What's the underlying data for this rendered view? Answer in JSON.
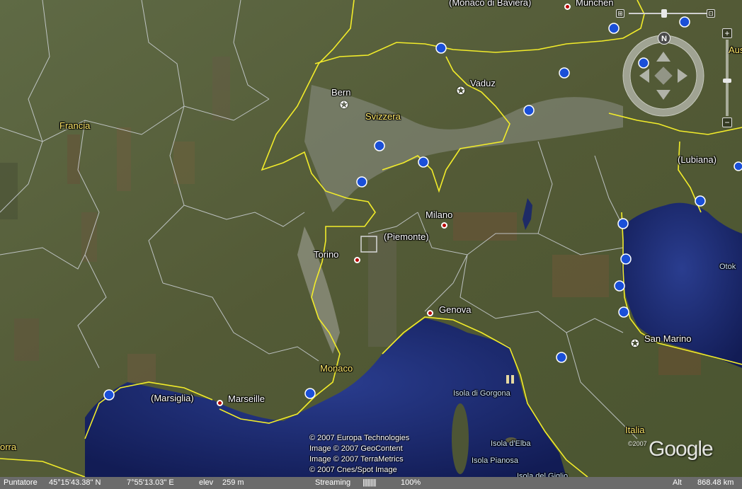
{
  "places": {
    "monaco_di_baviera": "(Monaco di Baviera)",
    "munchen": "München",
    "austria": "Austri",
    "bern": "Bern",
    "vaduz": "Vaduz",
    "svizzera": "Svizzera",
    "francia": "Francia",
    "lubiana": "(Lubiana)",
    "milano": "Milano",
    "piemonte": "(Piemonte)",
    "torino": "Torino",
    "genova": "Genova",
    "san_marino": "San Marino",
    "otok": "Otok",
    "monaco": "Monaco",
    "marsiglia": "(Marsiglia)",
    "marseille": "Marseille",
    "isola_gorgona": "Isola di Gorgona",
    "isola_elba": "Isola d'Elba",
    "isola_pianosa": "Isola Pianosa",
    "isola_giglio": "Isola del Giglio",
    "italia": "Italia",
    "orra": "orra"
  },
  "credits": [
    "© 2007 Europa Technologies",
    "Image © 2007 GeoContent",
    "Image © 2007 TerraMetrics",
    "© 2007 Cnes/Spot Image"
  ],
  "logo": {
    "text": "Google",
    "sup": "©2007"
  },
  "statusbar": {
    "pointer_label": "Puntatore",
    "lat": "45°15'43.38\" N",
    "lon": "7°55'13.03\" E",
    "elev_label": "elev",
    "elev_value": "259 m",
    "streaming_label": "Streaming",
    "streaming_bar": "||||||||||",
    "streaming_percent": "100%",
    "alt_label": "Alt",
    "alt_value": "868.48 km"
  },
  "controls": {
    "north_label": "N",
    "zoom_in": "+",
    "zoom_out": "−"
  },
  "colors": {
    "border": "#f2ec2a",
    "sea": "#1d2a6e",
    "land": "#55603c",
    "statusbar": "#6b6b6b"
  }
}
